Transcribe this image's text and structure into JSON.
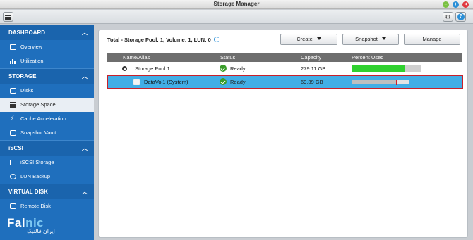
{
  "window": {
    "title": "Storage Manager"
  },
  "sidebar": {
    "sections": [
      {
        "label": "DASHBOARD",
        "items": [
          {
            "label": "Overview"
          },
          {
            "label": "Utilization"
          }
        ]
      },
      {
        "label": "STORAGE",
        "items": [
          {
            "label": "Disks"
          },
          {
            "label": "Storage Space"
          },
          {
            "label": "Cache Acceleration"
          },
          {
            "label": "Snapshot Vault"
          }
        ]
      },
      {
        "label": "iSCSI",
        "items": [
          {
            "label": "iSCSI Storage"
          },
          {
            "label": "LUN Backup"
          }
        ]
      },
      {
        "label": "VIRTUAL DISK",
        "items": [
          {
            "label": "Remote Disk"
          }
        ]
      }
    ],
    "active_item": "Storage Space"
  },
  "logo": {
    "brand_part1": "Fal",
    "brand_part2": "nic",
    "sub": "ایران فالنیک"
  },
  "main": {
    "summary": "Total - Storage Pool: 1, Volume: 1, LUN: 0",
    "buttons": {
      "create": "Create",
      "snapshot": "Snapshot",
      "manage": "Manage"
    },
    "columns": {
      "name": "Name/Alias",
      "status": "Status",
      "capacity": "Capacity",
      "percent": "Percent Used"
    },
    "rows": [
      {
        "name": "Storage Pool 1",
        "status": "Ready",
        "capacity": "279.11 GB",
        "percent_used": 0.75,
        "selected": false
      },
      {
        "name": "DataVol1 (System)",
        "status": "Ready",
        "capacity": "69.39 GB",
        "percent_used": 0.78,
        "selected": true
      }
    ]
  },
  "colors": {
    "sidebar": "#1f6fbd",
    "selection": "#42aee6",
    "selection_border": "#c8202a",
    "progress_fill": "#2fd12f"
  }
}
